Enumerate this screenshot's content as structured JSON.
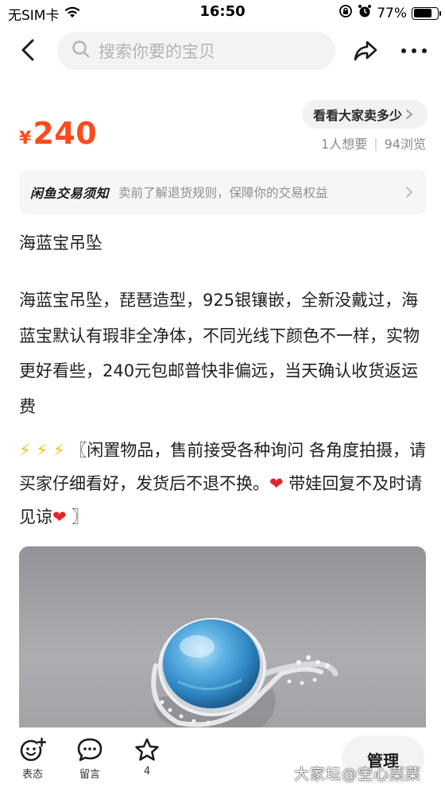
{
  "status_bar": {
    "carrier": "无SIM卡",
    "time": "16:50",
    "battery": "77%",
    "battery_level": 0.77
  },
  "nav": {
    "search_placeholder": "搜索你要的宝贝"
  },
  "price": {
    "currency_symbol": "¥",
    "amount": "240"
  },
  "sales_button": {
    "label": "看看大家卖多少"
  },
  "stats": {
    "wants": "1人想要",
    "views": "94浏览"
  },
  "notice": {
    "title": "闲鱼交易须知",
    "text": "卖前了解退货规则，保障你的交易权益"
  },
  "item": {
    "title": "海蓝宝吊坠",
    "description": "海蓝宝吊坠，琵琶造型，925银镶嵌，全新没戴过，海蓝宝默认有瑕非全净体，不同光线下颜色不一样，实物更好看些，240元包邮普快非偏远，当天确认收货返运费",
    "notes_bolts": "⚡ ⚡ ⚡",
    "notes_part1": " 〖闲置物品，售前接受各种询问 各角度拍摄，请买家仔细看好，发货后不退不换。",
    "notes_part2": " 带娃回复不及时请见谅",
    "notes_end": " 〗",
    "heart": "❤"
  },
  "bottom_bar": {
    "react_label": "表态",
    "comment_label": "留言",
    "favorite_count": "4",
    "manage_label": "管理"
  },
  "watermark": "大家坛@空心菜菜",
  "colors": {
    "price": "#ff4a1d",
    "bolt": "#f6c126",
    "heart": "#e0242a"
  },
  "icons": [
    "wifi-icon",
    "lock-rotation-icon",
    "alarm-icon",
    "battery-icon",
    "back-icon",
    "search-icon",
    "share-icon",
    "more-icon",
    "chevron-right-icon",
    "smile-plus-icon",
    "comment-icon",
    "star-icon"
  ]
}
